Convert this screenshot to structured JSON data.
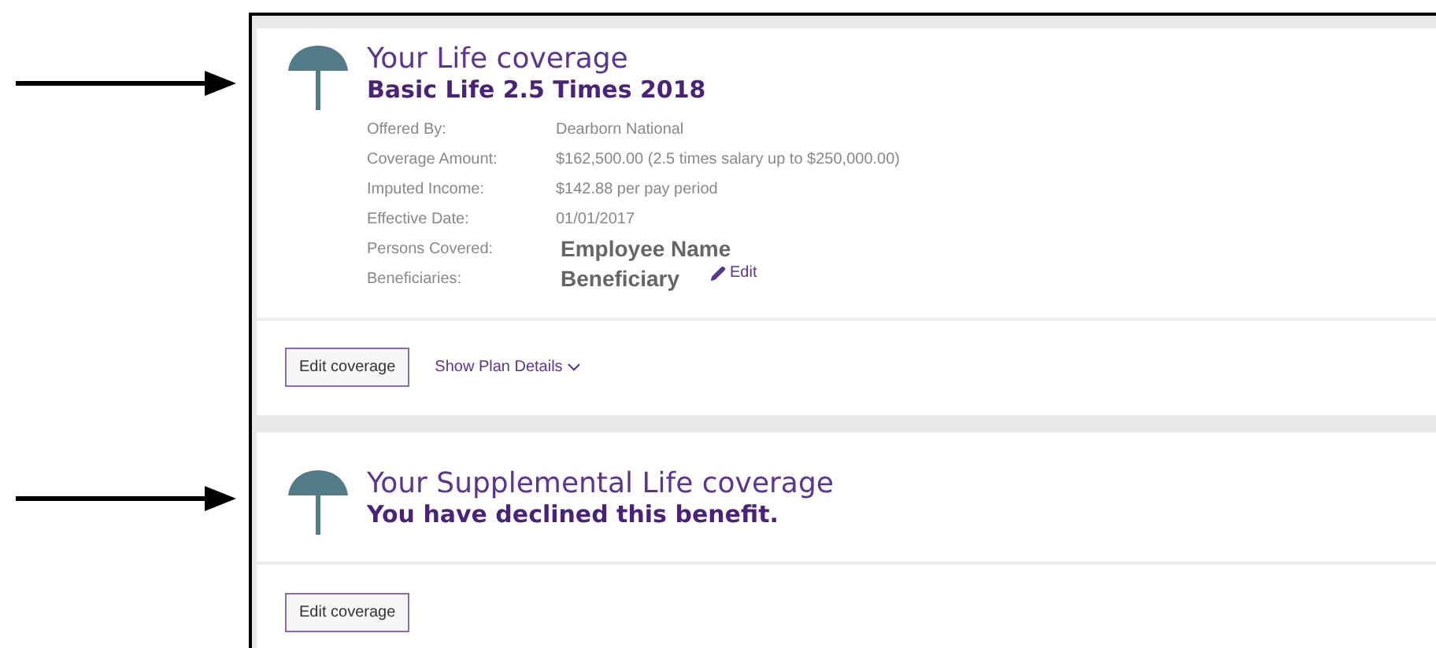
{
  "coverages": [
    {
      "pointer_arrow": true,
      "title": "Your Life coverage",
      "subtitle": "Basic Life 2.5 Times 2018",
      "details": [
        {
          "label": "Offered By:",
          "value": "Dearborn National",
          "emphasis": false
        },
        {
          "label": "Coverage Amount:",
          "value": "$162,500.00 (2.5 times salary up to $250,000.00)",
          "emphasis": false
        },
        {
          "label": "Imputed Income:",
          "value": "$142.88 per pay period",
          "emphasis": false
        },
        {
          "label": "Effective Date:",
          "value": "01/01/2017",
          "emphasis": false
        },
        {
          "label": "Persons Covered:",
          "value": "Employee Name",
          "emphasis": true
        },
        {
          "label": "Beneficiaries:",
          "value": "Beneficiary",
          "emphasis": true,
          "action": "Edit"
        }
      ],
      "button": "Edit coverage",
      "details_link": "Show Plan Details"
    },
    {
      "pointer_arrow": true,
      "title": "Your Supplemental Life coverage",
      "subtitle": "You have declined this benefit.",
      "button": "Edit coverage"
    }
  ]
}
